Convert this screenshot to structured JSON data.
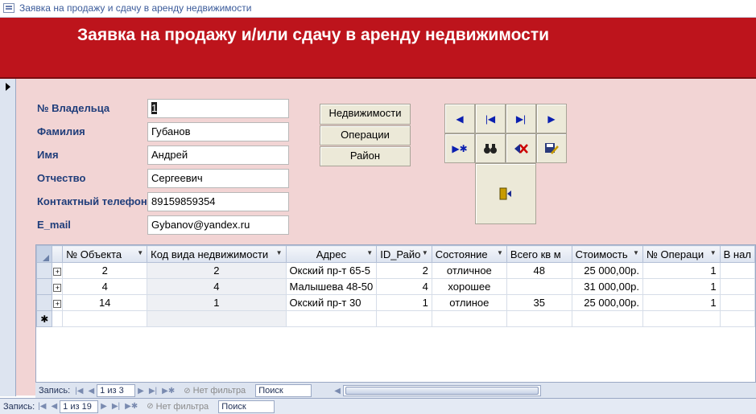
{
  "window": {
    "title": "Заявка на продажу и сдачу в аренду недвижимости"
  },
  "header": {
    "title": "Заявка на продажу и/или сдачу в аренду недвижимости"
  },
  "form": {
    "fields": [
      {
        "label": "№ Владельца",
        "value": "1"
      },
      {
        "label": "Фамилия",
        "value": "Губанов"
      },
      {
        "label": "Имя",
        "value": "Андрей"
      },
      {
        "label": "Отчество",
        "value": "Сергеевич"
      },
      {
        "label": "Контактный телефон",
        "value": "89159859354"
      },
      {
        "label": "E_mail",
        "value": "Gybanov@yandex.ru"
      }
    ],
    "buttons": {
      "realty": "Недвижимости",
      "operations": "Операции",
      "district": "Район"
    },
    "nav_icons": [
      "previous-record-icon",
      "first-record-icon",
      "last-record-icon",
      "next-record-icon",
      "new-record-icon",
      "find-record-icon",
      "delete-record-icon",
      "save-record-icon",
      "close-form-icon"
    ]
  },
  "datasheet": {
    "columns": [
      "№ Объекта",
      "Код вида недвижимости",
      "Адрес",
      "ID_Райо",
      "Состояние",
      "Всего кв м",
      "Стоимость",
      "№ Операци",
      "В нал"
    ],
    "rows": [
      [
        "2",
        "2",
        "Окский пр-т 65-5",
        "2",
        "отличное",
        "48",
        "25 000,00р.",
        "1",
        ""
      ],
      [
        "4",
        "4",
        "Малышева 48-50",
        "4",
        "хорошее",
        "",
        "31 000,00р.",
        "1",
        ""
      ],
      [
        "14",
        "1",
        "Окский пр-т  30",
        "1",
        "отлиное",
        "35",
        "25 000,00р.",
        "1",
        ""
      ]
    ],
    "new_row_marker": "✱",
    "nav": {
      "label": "Запись:",
      "position": "1 из 3",
      "filter": "Нет фильтра",
      "search": "Поиск"
    }
  },
  "form_nav": {
    "label": "Запись:",
    "position": "1 из 19",
    "filter": "Нет фильтра",
    "search": "Поиск"
  }
}
